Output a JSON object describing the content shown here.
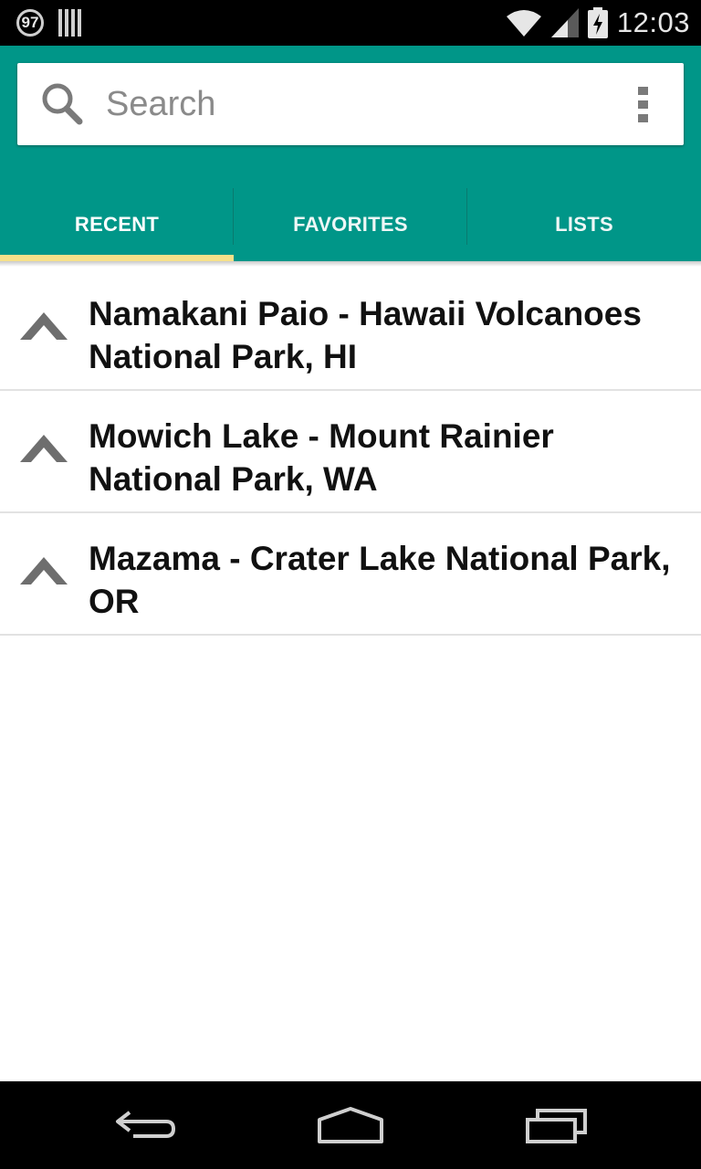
{
  "status_bar": {
    "notification_badge": "97",
    "time": "12:03",
    "icons": [
      "notification-97-icon",
      "barcode-icon",
      "wifi-icon",
      "signal-icon",
      "battery-charging-icon"
    ]
  },
  "search": {
    "placeholder": "Search",
    "icon": "search-icon",
    "menu_icon": "overflow-menu-icon"
  },
  "tabs": [
    {
      "label": "RECENT",
      "active": true
    },
    {
      "label": "FAVORITES",
      "active": false
    },
    {
      "label": "LISTS",
      "active": false
    }
  ],
  "recent_items": [
    {
      "name": "Namakani Paio - Hawaii Volcanoes National Park, HI",
      "icon": "tent-icon"
    },
    {
      "name": "Mowich Lake - Mount Rainier National Park, WA",
      "icon": "tent-icon"
    },
    {
      "name": "Mazama - Crater Lake National Park, OR",
      "icon": "tent-icon"
    }
  ],
  "nav_bar": {
    "buttons": [
      "back-icon",
      "home-icon",
      "recents-icon"
    ]
  },
  "colors": {
    "primary": "#009688",
    "tab_indicator": "#f6e08a",
    "icon_gray": "#6e6e6e"
  }
}
